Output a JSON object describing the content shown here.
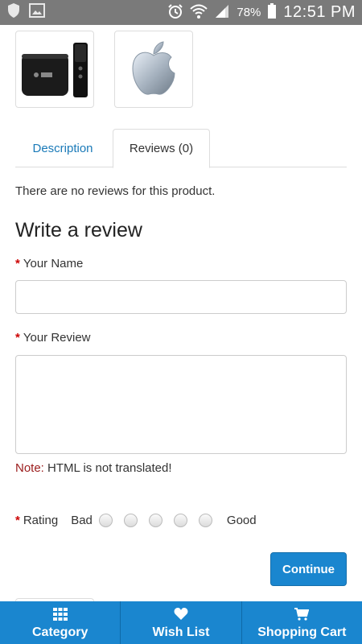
{
  "status_bar": {
    "battery": "78%",
    "time": "12:51 PM"
  },
  "thumbnails": [
    {
      "icon": "apple-tv-image"
    },
    {
      "icon": "apple-logo-image"
    }
  ],
  "tabs": [
    {
      "label": "Description",
      "active": false
    },
    {
      "label": "Reviews (0)",
      "active": true
    }
  ],
  "reviews": {
    "empty_text": "There are no reviews for this product.",
    "heading": "Write a review",
    "required_mark": "*",
    "name_label": "Your Name",
    "name_value": "",
    "review_label": "Your Review",
    "review_value": "",
    "note_key": "Note:",
    "note_text": " HTML is not translated!",
    "rating_label": "Rating",
    "rating_bad": "Bad",
    "rating_good": "Good",
    "continue_label": "Continue"
  },
  "bottom_nav": [
    {
      "label": "Category",
      "icon": "grid-icon"
    },
    {
      "label": "Wish List",
      "icon": "heart-icon"
    },
    {
      "label": "Shopping Cart",
      "icon": "cart-icon"
    }
  ],
  "colors": {
    "accent": "#1a86cf",
    "tab_link": "#1a7ab8",
    "required": "#cc0000",
    "note": "#9b1c1c"
  }
}
